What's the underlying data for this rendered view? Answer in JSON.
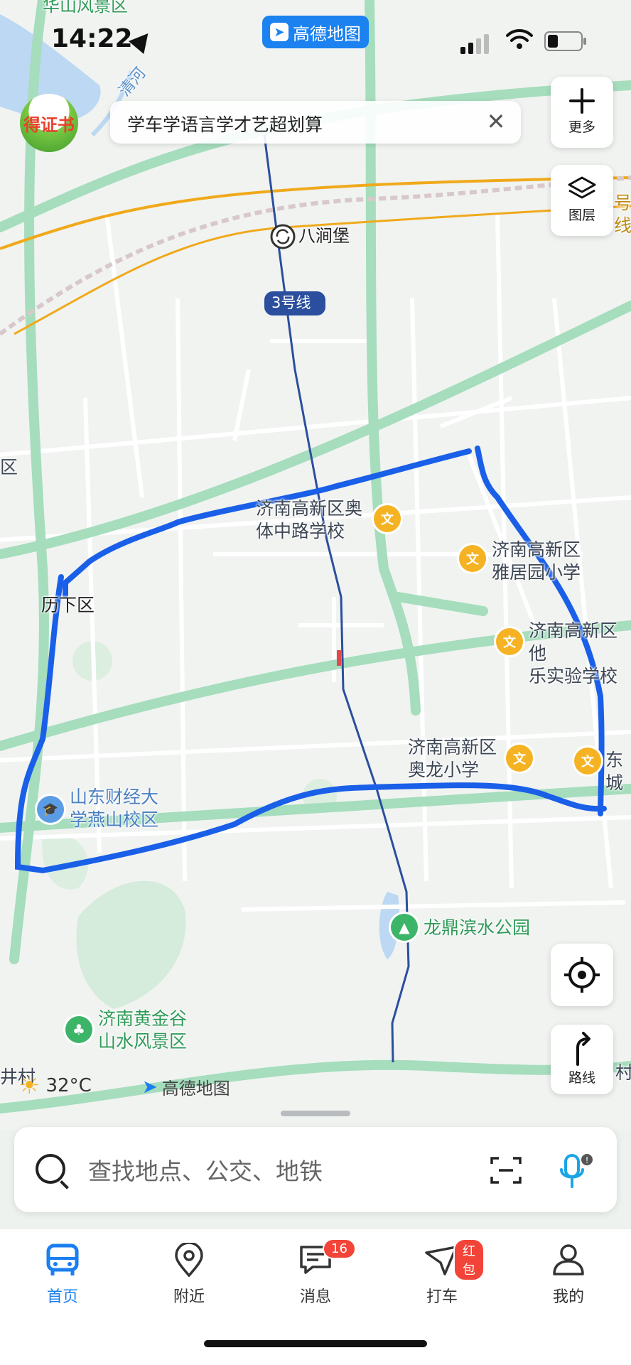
{
  "status_bar": {
    "time": "14:22",
    "app_badge": "高德地图"
  },
  "promo": {
    "logo_text": "得证书",
    "banner_text": "学车学语言学才艺超划算"
  },
  "controls": {
    "more_label": "更多",
    "layers_label": "图层",
    "route_label": "路线"
  },
  "map": {
    "labels": {
      "top_scenic": "华山风景区",
      "river": "清河",
      "station": "八涧堡",
      "metro_line": "3号线",
      "district_left": "区",
      "lixia": "历下区",
      "school_aoti": "济南高新区奥\n体中路学校",
      "school_yajuyuan": "济南高新区\n雅居园小学",
      "school_shiyan": "济南高新区他\n乐实验学校",
      "school_aolong": "济南高新区\n奥龙小学",
      "east_label": "东城",
      "university": "山东财经大\n学燕山校区",
      "park": "龙鼎滨水公园",
      "scenic_bottom": "济南黄金谷\n山水风景区",
      "right_edge": "号线",
      "bottom_left": "井村",
      "bottom_right": "村"
    },
    "weather": "32°C",
    "brand": "高德地图",
    "colors": {
      "route": "#1a5fe8",
      "metro": "#2b4f9e",
      "road_major": "#9fdcb8",
      "rail": "#f0a91b"
    }
  },
  "search": {
    "placeholder": "查找地点、公交、地铁"
  },
  "bottom_nav": {
    "items": [
      {
        "label": "首页",
        "icon": "bus-icon"
      },
      {
        "label": "附近",
        "icon": "location-pin-icon"
      },
      {
        "label": "消息",
        "icon": "message-icon",
        "badge": "16"
      },
      {
        "label": "打车",
        "icon": "taxi-icon",
        "badge": "红包"
      },
      {
        "label": "我的",
        "icon": "user-icon"
      }
    ]
  }
}
